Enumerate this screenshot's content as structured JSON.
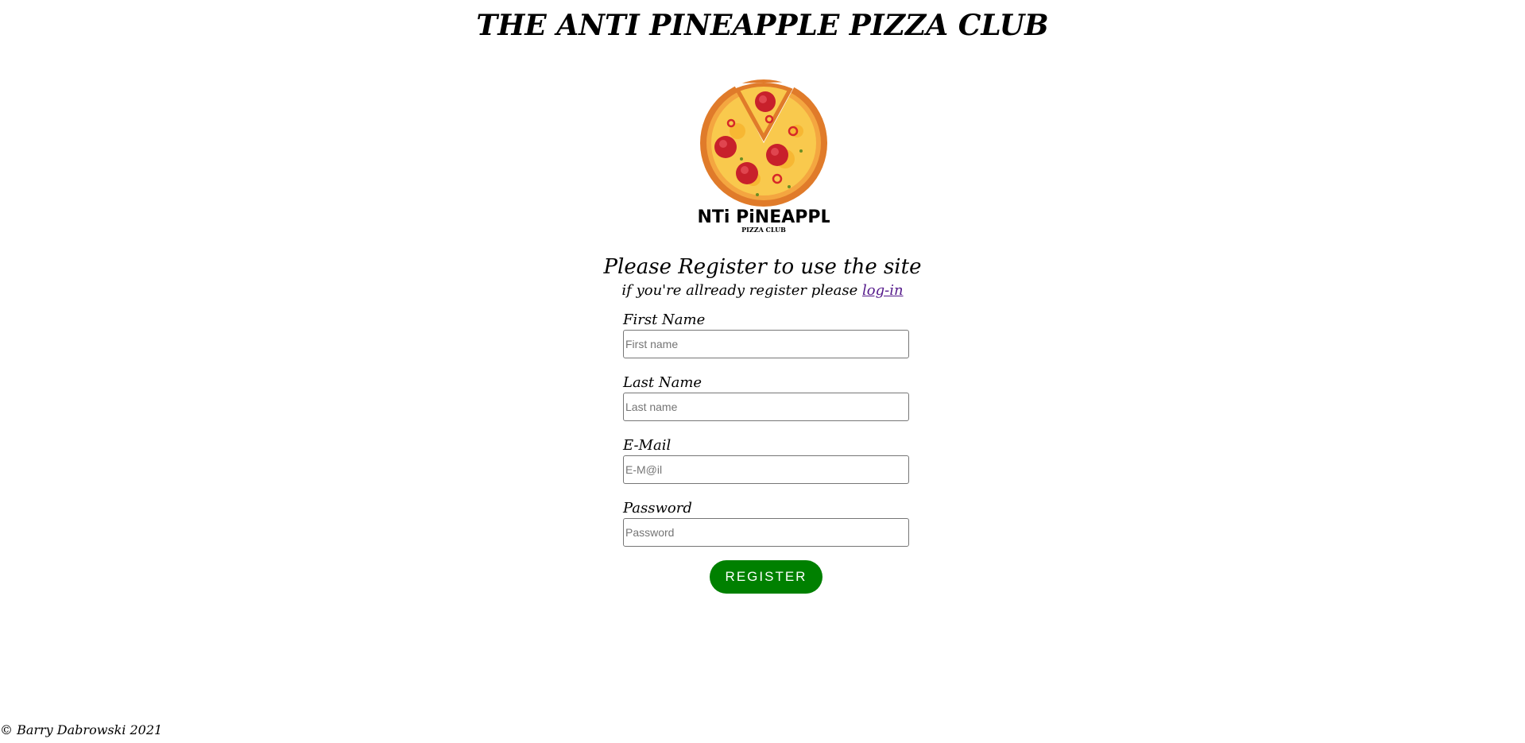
{
  "site_title": "THE ANTI PINEAPPLE PIZZA CLUB",
  "logo": {
    "text_main": "ANTi PiNEAPPLE",
    "text_sub": "PIZZA CLUB"
  },
  "register": {
    "heading": "Please Register to use the site",
    "sub_text": "if you're allready register please",
    "login_link": "log-in"
  },
  "form": {
    "fields": [
      {
        "label": "First Name",
        "placeholder": "First name",
        "value": ""
      },
      {
        "label": "Last Name",
        "placeholder": "Last name",
        "value": ""
      },
      {
        "label": "E-Mail",
        "placeholder": "E-M@il",
        "value": ""
      },
      {
        "label": "Password",
        "placeholder": "Password",
        "value": ""
      }
    ],
    "submit_label": "REGISTER"
  },
  "footer": {
    "copyright": "© Barry Dabrowski 2021"
  },
  "colors": {
    "button_bg": "#008000",
    "link": "#551a8b"
  }
}
